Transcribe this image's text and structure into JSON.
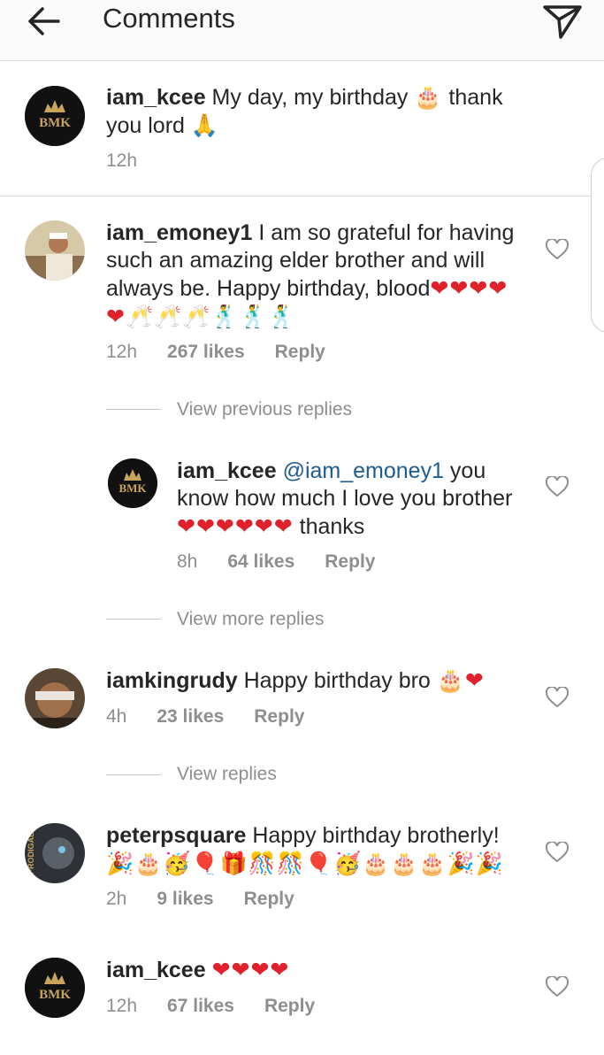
{
  "header": {
    "title": "Comments"
  },
  "caption": {
    "username": "iam_kcee",
    "text_before": " My day, my birthday ",
    "emoji1": "🎂",
    "text_after": " thank you lord ",
    "emoji2": "🙏",
    "time": "12h",
    "avatar_text": "BMK"
  },
  "comments": [
    {
      "username": "iam_emoney1",
      "text": " I am so grateful for having such an amazing elder brother and will always be. Happy birthday, blood",
      "hearts": "❤❤❤❤❤",
      "glasses": "🥂🥂🥂",
      "dancers": "🕺🕺🕺",
      "time": "12h",
      "likes": "267 likes",
      "reply": "Reply"
    },
    {
      "username": "iam_kcee",
      "mention": "@iam_emoney1",
      "text": " you know how much I love you brother ",
      "hearts": "❤❤❤❤❤❤",
      "text_after": " thanks",
      "time": "8h",
      "likes": "64 likes",
      "reply": "Reply"
    },
    {
      "username": "iamkingrudy",
      "text": " Happy birthday bro ",
      "emoji": "🎂",
      "hearts": "❤",
      "time": "4h",
      "likes": "23 likes",
      "reply": "Reply"
    },
    {
      "username": "peterpsquare",
      "text": " Happy birthday brotherly!",
      "emojis": "🎉🎂🥳🎈🎁🎊🎊🎈🥳🎂🎂🎂🎉🎉",
      "time": "2h",
      "likes": "9 likes",
      "reply": "Reply",
      "avatar_text": "PRODIGAL"
    },
    {
      "username": "iam_kcee",
      "hearts": "❤❤❤❤",
      "time": "12h",
      "likes": "67 likes",
      "reply": "Reply"
    }
  ],
  "view_links": {
    "previous": "View previous replies",
    "more": "View more replies",
    "replies": "View replies"
  },
  "colors": {
    "heart": "#e0202a",
    "mention": "#1e5b8f",
    "meta": "#8e8e8e"
  }
}
